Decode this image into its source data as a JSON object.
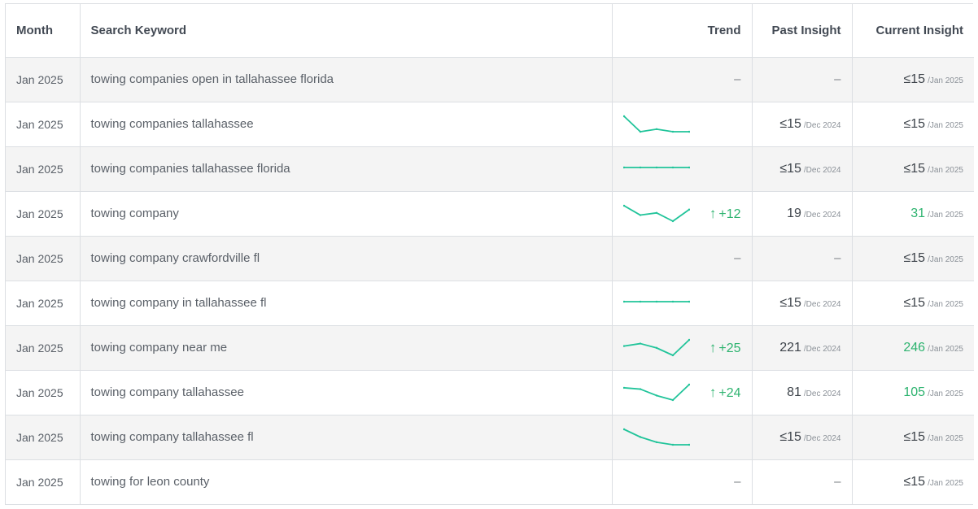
{
  "headers": {
    "month": "Month",
    "keyword": "Search Keyword",
    "trend": "Trend",
    "past": "Past Insight",
    "current": "Current Insight"
  },
  "colors": {
    "spark": "#21c49a",
    "positive": "#2db36f"
  },
  "rows": [
    {
      "month": "Jan 2025",
      "keyword": "towing companies open in tallahassee florida",
      "trend": null,
      "change": "",
      "trend_dash": "–",
      "past": null,
      "past_dash": "–",
      "past_date": "",
      "current": "≤15",
      "current_date": "/Jan 2025",
      "current_green": false
    },
    {
      "month": "Jan 2025",
      "keyword": "towing companies tallahassee",
      "trend": [
        22,
        10,
        12,
        10,
        10
      ],
      "change": "",
      "trend_dash": "",
      "past": "≤15",
      "past_dash": "",
      "past_date": "/Dec 2024",
      "current": "≤15",
      "current_date": "/Jan 2025",
      "current_green": false
    },
    {
      "month": "Jan 2025",
      "keyword": "towing companies tallahassee florida",
      "trend": [
        10,
        10,
        10,
        10,
        10
      ],
      "change": "",
      "trend_dash": "",
      "past": "≤15",
      "past_dash": "",
      "past_date": "/Dec 2024",
      "current": "≤15",
      "current_date": "/Jan 2025",
      "current_green": false
    },
    {
      "month": "Jan 2025",
      "keyword": "towing company",
      "trend": [
        38,
        21,
        25,
        10,
        31
      ],
      "change": "+12",
      "trend_dash": "",
      "past": "19",
      "past_dash": "",
      "past_date": "/Dec 2024",
      "current": "31",
      "current_date": "/Jan 2025",
      "current_green": true
    },
    {
      "month": "Jan 2025",
      "keyword": "towing company crawfordville fl",
      "trend": null,
      "change": "",
      "trend_dash": "–",
      "past": null,
      "past_dash": "–",
      "past_date": "",
      "current": "≤15",
      "current_date": "/Jan 2025",
      "current_green": false
    },
    {
      "month": "Jan 2025",
      "keyword": "towing company in tallahassee fl",
      "trend": [
        10,
        10,
        10,
        10,
        10
      ],
      "change": "",
      "trend_dash": "",
      "past": "≤15",
      "past_dash": "",
      "past_date": "/Dec 2024",
      "current": "≤15",
      "current_date": "/Jan 2025",
      "current_green": false
    },
    {
      "month": "Jan 2025",
      "keyword": "towing company near me",
      "trend": [
        236,
        240,
        233,
        221,
        246
      ],
      "change": "+25",
      "trend_dash": "",
      "past": "221",
      "past_dash": "",
      "past_date": "/Dec 2024",
      "current": "246",
      "current_date": "/Jan 2025",
      "current_green": true
    },
    {
      "month": "Jan 2025",
      "keyword": "towing company tallahassee",
      "trend": [
        100,
        98,
        88,
        81,
        105
      ],
      "change": "+24",
      "trend_dash": "",
      "past": "81",
      "past_dash": "",
      "past_date": "/Dec 2024",
      "current": "105",
      "current_date": "/Jan 2025",
      "current_green": true
    },
    {
      "month": "Jan 2025",
      "keyword": "towing company tallahassee fl",
      "trend": [
        22,
        16,
        12,
        10,
        10
      ],
      "change": "",
      "trend_dash": "",
      "past": "≤15",
      "past_dash": "",
      "past_date": "/Dec 2024",
      "current": "≤15",
      "current_date": "/Jan 2025",
      "current_green": false
    },
    {
      "month": "Jan 2025",
      "keyword": "towing for leon county",
      "trend": null,
      "change": "",
      "trend_dash": "–",
      "past": null,
      "past_dash": "–",
      "past_date": "",
      "current": "≤15",
      "current_date": "/Jan 2025",
      "current_green": false
    }
  ]
}
